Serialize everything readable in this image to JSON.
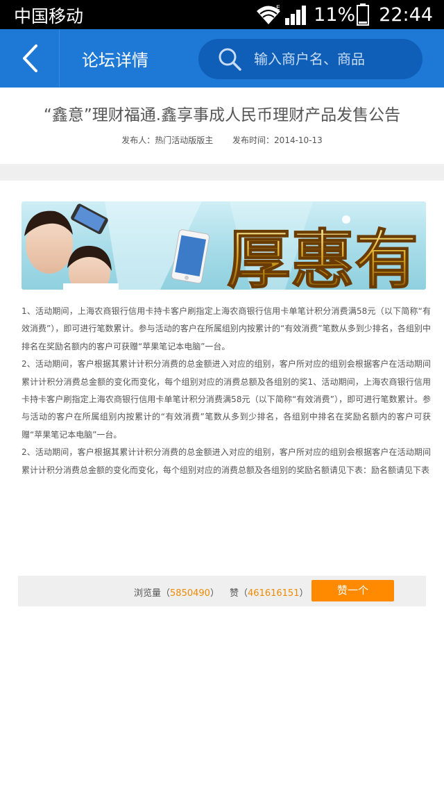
{
  "statusbar": {
    "carrier": "中国移动",
    "battery": "11%",
    "time": "22:44"
  },
  "header": {
    "title": "论坛详情",
    "search_placeholder": "输入商户名、商品"
  },
  "article": {
    "title": "“鑫意”理财福通.鑫享事成人民币理财产品发售公告",
    "publisher_label": "发布人：热门活动版版主",
    "publish_time_label": "发布时间：2014-10-13",
    "banner_text": "厚惠有",
    "paragraphs": [
      "1、活动期间，上海农商银行信用卡持卡客户刷指定上海农商银行信用卡单笔计积分消费满58元（以下简称“有效消费”），即可进行笔数累计。参与活动的客户在所属组别内按累计的“有效消费”笔数从多到少排名，各组别中排名在奖励名额内的客户可获赠“苹果笔记本电脑”一台。",
      "2、活动期间，客户根据其累计计积分消费的总金额进入对应的组别，客户所对应的组别会根据客户在活动期间累计计积分消费总金额的变化而变化，每个组别对应的消费总额及各组别的奖1、活动期间，上海农商银行信用卡持卡客户刷指定上海农商银行信用卡单笔计积分消费满58元（以下简称“有效消费”），即可进行笔数累计。参与活动的客户在所属组别内按累计的“有效消费”笔数从多到少排名，各组别中排名在奖励名额内的客户可获赠“苹果笔记本电脑”一台。",
      "2、活动期间，客户根据其累计计积分消费的总金额进入对应的组别，客户所对应的组别会根据客户在活动期间累计计积分消费总金额的变化而变化，每个组别对应的消费总额及各组别的奖励名额请见下表：励名额请见下表"
    ]
  },
  "stats": {
    "views_label": "浏览量",
    "views_open": "（",
    "views_value": "5850490",
    "views_close": "）",
    "likes_label": "赞",
    "likes_open": "（",
    "likes_value": "461616151",
    "likes_close": "）",
    "like_button": "赞一个"
  },
  "icons": {
    "back": "chevron-left-icon",
    "search": "search-icon",
    "wifi": "wifi-icon",
    "signal": "signal-icon",
    "battery": "battery-icon"
  },
  "colors": {
    "header_bg": "#1e78d6",
    "search_bg": "#0f5fb8",
    "accent_orange": "#ff8a00",
    "number_orange": "#f08a00"
  }
}
